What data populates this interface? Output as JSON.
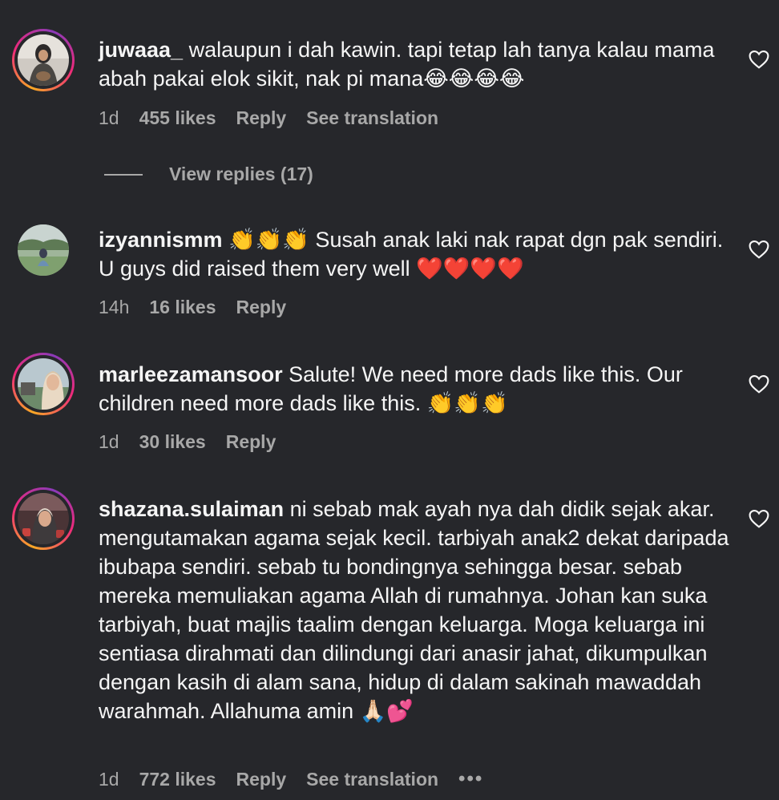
{
  "comments": [
    {
      "username": "juwaaa_",
      "text": "walaupun i dah kawin. tapi tetap lah tanya kalau mama abah pakai elok sikit, nak pi mana😂😂😂😂",
      "time": "1d",
      "likes": "455 likes",
      "reply": "Reply",
      "translation": "See translation"
    },
    {
      "username": "izyannismm",
      "text": "👏👏👏 Susah anak laki nak rapat dgn pak sendiri. U guys did raised them very well ❤️❤️❤️❤️",
      "time": "14h",
      "likes": "16 likes",
      "reply": "Reply"
    },
    {
      "username": "marleezamansoor",
      "text": "Salute! We need more dads like this. Our children need more dads like this. 👏👏👏",
      "time": "1d",
      "likes": "30 likes",
      "reply": "Reply"
    },
    {
      "username": "shazana.sulaiman",
      "text": "ni sebab mak ayah nya dah didik sejak akar. mengutamakan agama sejak kecil. tarbiyah anak2 dekat daripada ibubapa sendiri. sebab tu bondingnya sehingga besar. sebab mereka memuliakan agama Allah di rumahnya. Johan kan suka tarbiyah, buat majlis taalim dengan keluarga. Moga keluarga ini sentiasa dirahmati dan dilindungi dari anasir jahat, dikumpulkan dengan kasih di alam sana, hidup di dalam sakinah mawaddah warahmah. Allahuma amin 🙏🏻💕",
      "time": "1d",
      "likes": "772 likes",
      "reply": "Reply",
      "translation": "See translation",
      "more": "•••"
    }
  ],
  "view_replies": "View replies (17)",
  "icons": {
    "like": "heart-outline-icon"
  },
  "colors": {
    "background": "#26272b",
    "text": "#f5f5f5",
    "muted": "#a8a8a8"
  }
}
